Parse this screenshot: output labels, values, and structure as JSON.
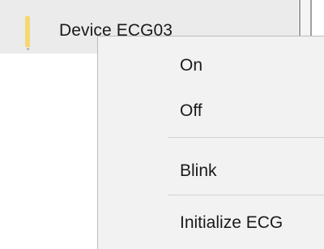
{
  "tree": {
    "device_label": "Device ECG03",
    "status_color": "#f7d774"
  },
  "context_menu": {
    "items": [
      {
        "label": "On"
      },
      {
        "label": "Off"
      },
      {
        "label": "Blink"
      },
      {
        "label": "Initialize ECG"
      }
    ]
  }
}
